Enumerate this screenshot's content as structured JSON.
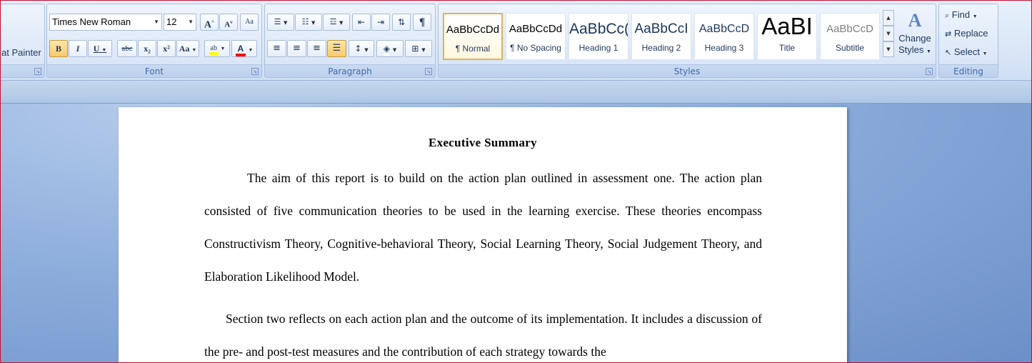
{
  "clipboard": {
    "format_painter_label": "at Painter"
  },
  "font": {
    "group_label": "Font",
    "font_name": "Times New Roman",
    "font_size": "12",
    "grow_label": "A",
    "shrink_label": "A",
    "clear_label": "Aa",
    "bold_label": "B",
    "italic_label": "I",
    "underline_label": "U",
    "strike_label": "abc",
    "subscript_label": "x₂",
    "superscript_label": "x²",
    "case_label": "Aa",
    "highlight_label": "ab",
    "font_color_label": "A"
  },
  "paragraph": {
    "group_label": "Paragraph",
    "show_marks_label": "¶"
  },
  "styles": {
    "group_label": "Styles",
    "tiles": [
      {
        "preview": "AaBbCcDd",
        "name": "¶ Normal"
      },
      {
        "preview": "AaBbCcDd",
        "name": "¶ No Spacing"
      },
      {
        "preview": "AaBbCc(",
        "name": "Heading 1"
      },
      {
        "preview": "AaBbCcI",
        "name": "Heading 2"
      },
      {
        "preview": "AaBbCcD",
        "name": "Heading 3"
      },
      {
        "preview": "AaBI",
        "name": "Title"
      },
      {
        "preview": "AaBbCcD",
        "name": "Subtitle"
      }
    ],
    "change_styles_line1": "Change",
    "change_styles_line2": "Styles"
  },
  "editing": {
    "group_label": "Editing",
    "find_label": "Find",
    "replace_label": "Replace",
    "select_label": "Select"
  },
  "document": {
    "title": "Executive Summary",
    "paragraph1": "The aim of this report is to build on the action plan outlined in assessment one. The action plan consisted of five communication theories to be used in the learning exercise. These theories encompass Constructivism Theory, Cognitive-behavioral Theory, Social Learning Theory, Social Judgement Theory, and Elaboration Likelihood Model.",
    "paragraph2": "Section two reflects on each action plan and the outcome of its implementation. It includes a discussion of the pre- and post-test measures and the contribution of each strategy towards the"
  },
  "colors": {
    "highlight": "#ffff00",
    "font_color": "#ff0000",
    "selected_style_border": "#e9b04b"
  }
}
